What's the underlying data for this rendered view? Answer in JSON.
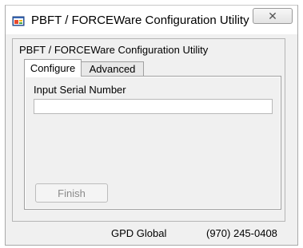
{
  "window": {
    "title": "PBFT / FORCEWare Configuration Utility",
    "close_glyph": "✕",
    "icon": "app-window-icon"
  },
  "group": {
    "title": "PBFT / FORCEWare Configuration Utility"
  },
  "tabs": [
    {
      "label": "Configure",
      "selected": true
    },
    {
      "label": "Advanced",
      "selected": false
    }
  ],
  "configure": {
    "serial_label": "Input Serial Number",
    "serial_value": "",
    "finish_label": "Finish",
    "finish_enabled": false
  },
  "footer": {
    "company": "GPD Global",
    "phone": "(970) 245-0408"
  }
}
